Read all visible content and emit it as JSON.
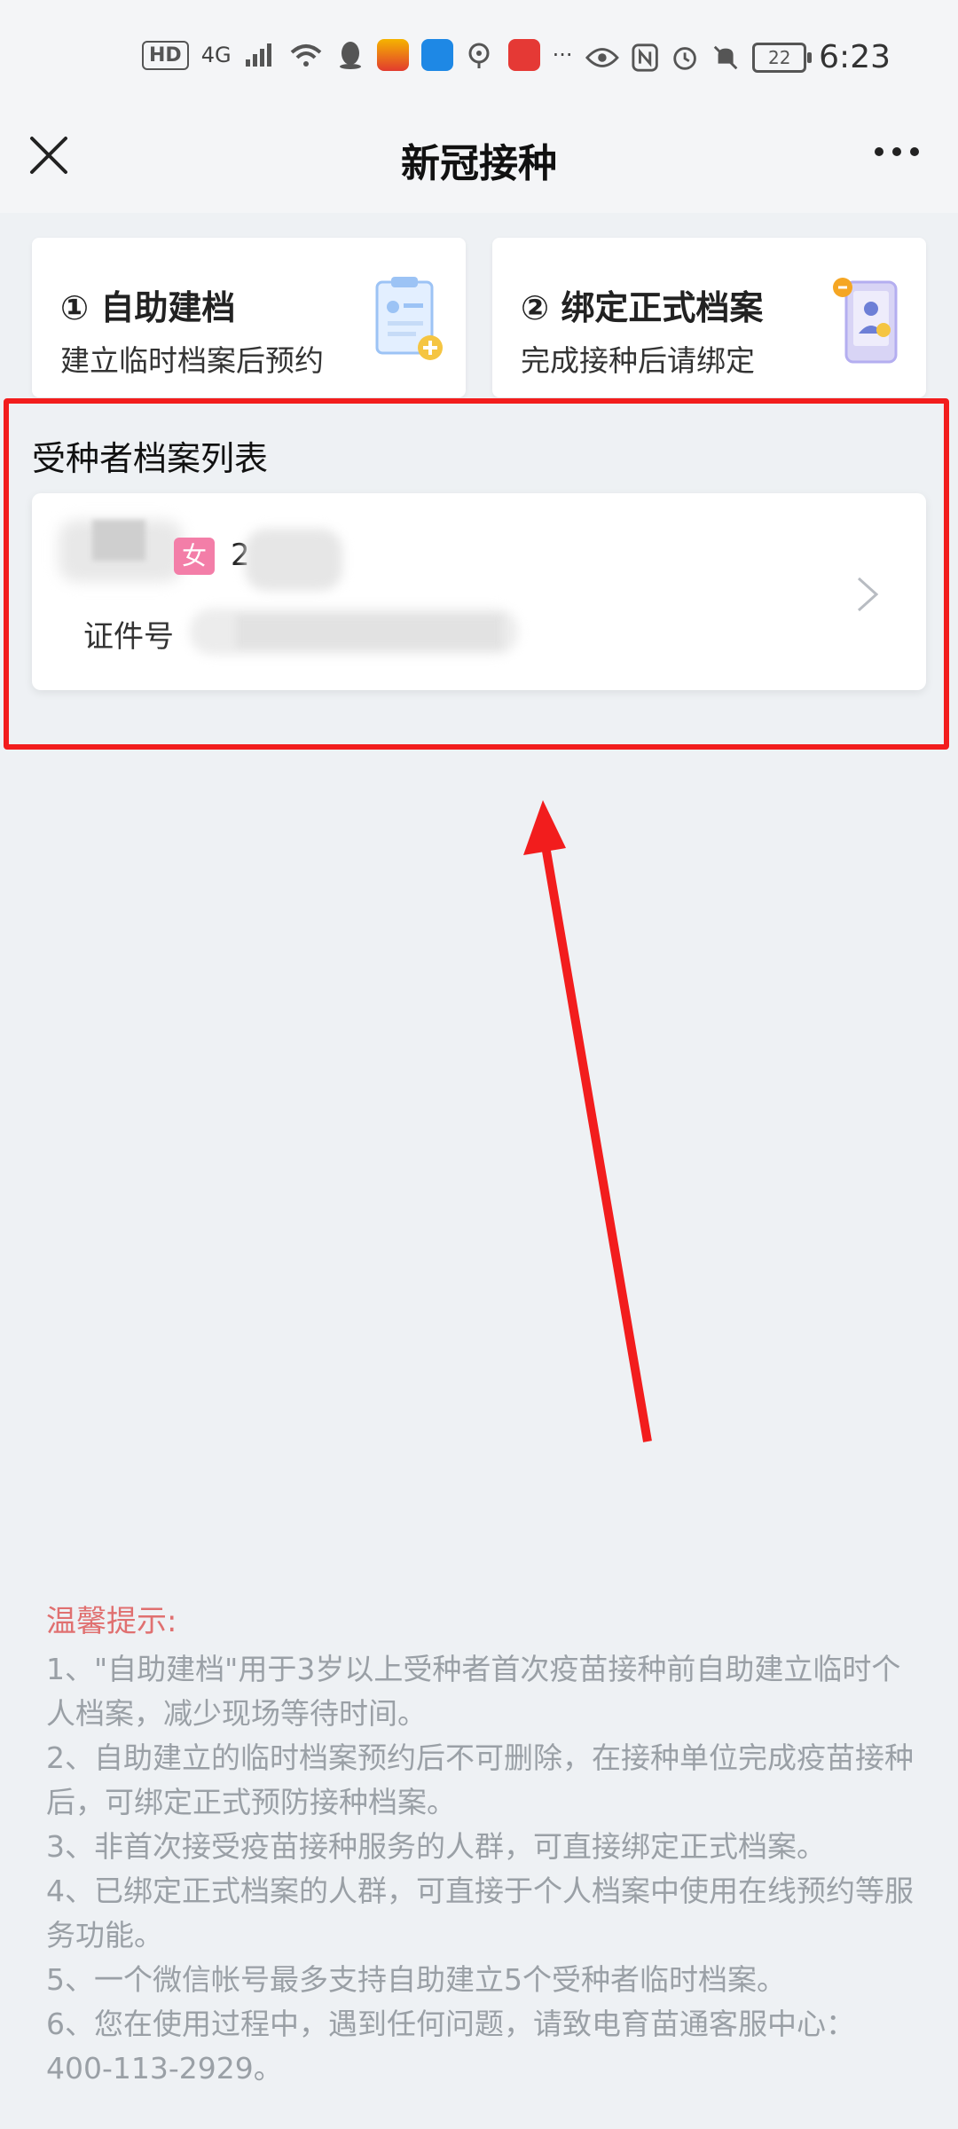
{
  "status_bar": {
    "network_badge": "HD",
    "signal_text": "4G",
    "battery_level": "22",
    "time": "6:23"
  },
  "header": {
    "title": "新冠接种"
  },
  "cards": [
    {
      "title": "① 自助建档",
      "subtitle": "建立临时档案后预约"
    },
    {
      "title": "② 绑定正式档案",
      "subtitle": "完成接种后请绑定"
    }
  ],
  "list": {
    "title": "受种者档案列表",
    "records": [
      {
        "gender": "女",
        "name_partial": "2",
        "id_label": "证件号"
      }
    ]
  },
  "tips": {
    "title": "温馨提示:",
    "lines": [
      "1、\"自助建档\"用于3岁以上受种者首次疫苗接种前自助建立临时个人档案，减少现场等待时间。",
      "2、自助建立的临时档案预约后不可删除，在接种单位完成疫苗接种后，可绑定正式预防接种档案。",
      "3、非首次接受疫苗接种服务的人群，可直接绑定正式档案。",
      "4、已绑定正式档案的人群，可直接于个人档案中使用在线预约等服务功能。",
      "5、一个微信帐号最多支持自助建立5个受种者临时档案。",
      "6、您在使用过程中，遇到任何问题，请致电育苗通客服中心：400-113-2929。"
    ]
  },
  "colors": {
    "annotation_red": "#f21d1d",
    "tips_title": "#e07070",
    "gender_female": "#f37ea8"
  }
}
